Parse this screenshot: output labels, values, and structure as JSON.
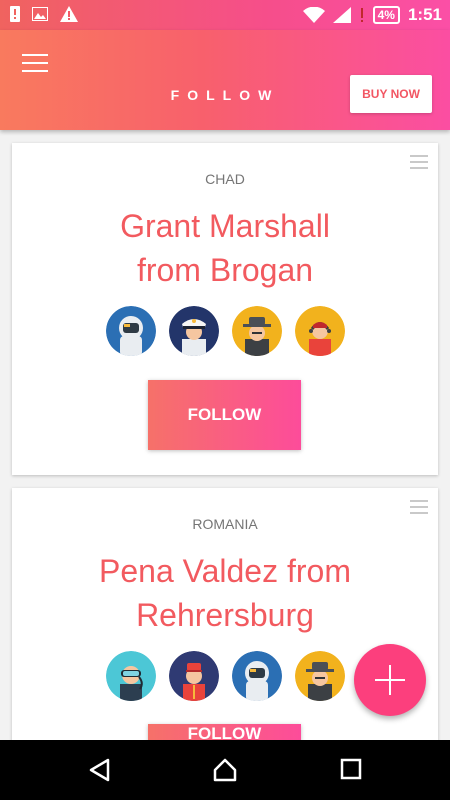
{
  "status_bar": {
    "battery": "4%",
    "time": "1:51"
  },
  "app_bar": {
    "title": "FOLLOW",
    "buy_button": "BUY NOW"
  },
  "cards": [
    {
      "country": "CHAD",
      "name_line1": "Grant Marshall",
      "name_line2": "from Brogan",
      "follow_label": "FOLLOW",
      "avatars": [
        "astronaut-avatar",
        "captain-avatar",
        "detective-avatar",
        "support-agent-avatar"
      ]
    },
    {
      "country": "ROMANIA",
      "name_line1": "Pena Valdez from",
      "name_line2": "Rehrersburg",
      "follow_label": "FOLLOW",
      "avatars": [
        "diver-avatar",
        "bellhop-avatar",
        "astronaut-avatar",
        "detective-avatar"
      ]
    }
  ],
  "fab": {
    "icon": "plus-icon"
  },
  "colors": {
    "accent": "#f25a5f",
    "gradient_start": "#f67169",
    "gradient_end": "#fd4c9a",
    "fab": "#fc3f7d"
  }
}
